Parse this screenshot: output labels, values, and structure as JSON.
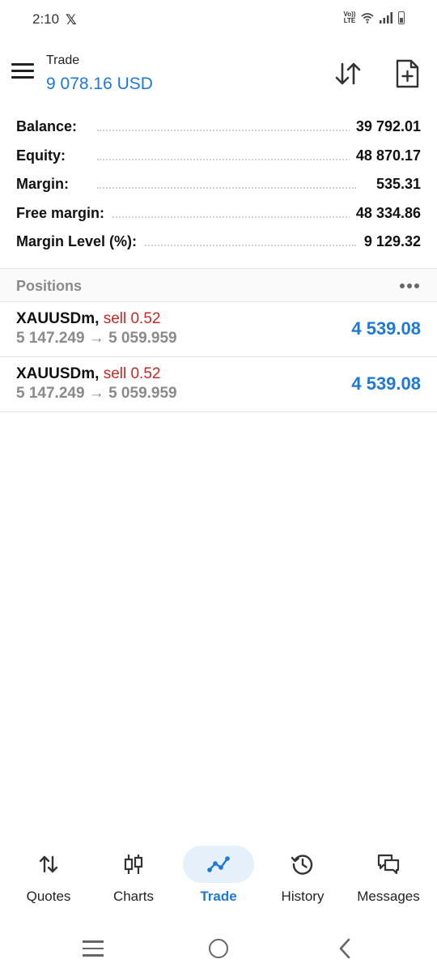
{
  "status_bar": {
    "time": "2:10",
    "x_glyph": "𝕏",
    "network_label_top": "Vo))",
    "network_label_bottom": "LTE"
  },
  "header": {
    "subtitle": "Trade",
    "amount": "9 078.16 USD",
    "accent_color": "#1e78d6"
  },
  "account": {
    "rows": [
      {
        "label": "Balance:",
        "value": "39 792.01"
      },
      {
        "label": "Equity:",
        "value": "48 870.17"
      },
      {
        "label": "Margin:",
        "value": "535.31"
      },
      {
        "label": "Free margin:",
        "value": "48 334.86"
      },
      {
        "label": "Margin Level (%):",
        "value": "9 129.32"
      }
    ]
  },
  "positions": {
    "title": "Positions",
    "items": [
      {
        "symbol": "XAUUSDm,",
        "side": "sell 0.52",
        "prices": "5 147.249 → 5 059.959",
        "profit": "4 539.08"
      },
      {
        "symbol": "XAUUSDm,",
        "side": "sell 0.52",
        "prices": "5 147.249 → 5 059.959",
        "profit": "4 539.08"
      }
    ],
    "sell_color": "#c62828"
  },
  "bottom_nav": {
    "items": [
      {
        "label": "Quotes",
        "icon": "quotes-icon"
      },
      {
        "label": "Charts",
        "icon": "charts-icon"
      },
      {
        "label": "Trade",
        "icon": "trade-icon",
        "active": true
      },
      {
        "label": "History",
        "icon": "history-icon"
      },
      {
        "label": "Messages",
        "icon": "messages-icon"
      }
    ]
  }
}
